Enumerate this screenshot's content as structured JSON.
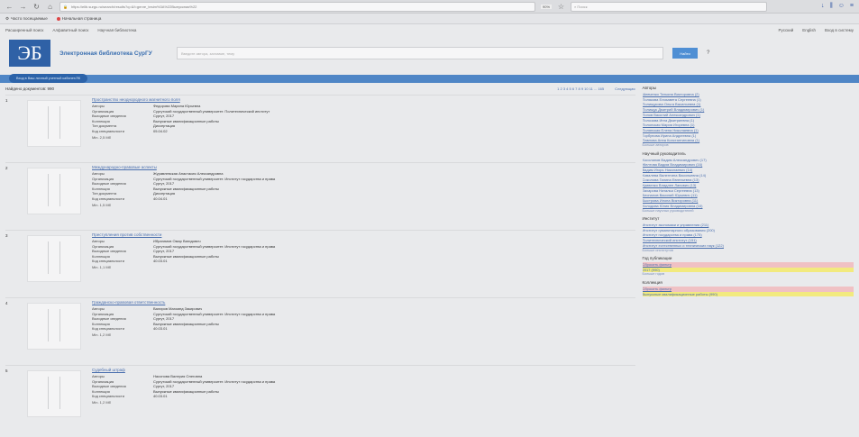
{
  "browser": {
    "url": "https://elib.surgu.ru/search/results?q=&f=genre_tesim%3A%22Выпускная%22",
    "zoom": "90%",
    "search_placeholder": "Поиск"
  },
  "bookmarks": [
    {
      "label": "Часто посещаемые"
    },
    {
      "label": "Начальная страница"
    }
  ],
  "topnav": {
    "links": [
      "Расширенный поиск",
      "Алфавитный поиск",
      "Научная библиотека"
    ],
    "lang_ru": "Русский",
    "lang_en": "English",
    "login": "Вход в систему"
  },
  "header": {
    "logo": "ЭБ",
    "title": "Электронная библиотека СурГУ",
    "search_placeholder": "Введите автора, заглавие, тему",
    "search_button": "Найти",
    "help": "?"
  },
  "band": {
    "pill": "Вход в Ваш личный учетный кабинет/ЛК"
  },
  "results": {
    "found": "Найдено документов: 990",
    "pages": "1 2 3 4 5 6 7 8 9 10 11 ... 165",
    "next": "Следующая",
    "labels": {
      "authors": "Авторы",
      "org": "Организация",
      "imprint": "Выходные сведения",
      "collection": "Коллекция",
      "doctype": "Тип документа",
      "code": "Код специальности"
    },
    "items": [
      {
        "num": "1",
        "title": "Пространство неоднородного магнитного поля",
        "authors": "Федорова Марина Юрьевна",
        "org": "Сургутский государственный университет. Политехнический институт",
        "imprint": "Сургут, 2017",
        "collection": "Выпускные квалификационные работы",
        "doctype": "Диссертация",
        "code": "05.04.02",
        "size": "Min. 2,5 Мб"
      },
      {
        "num": "2",
        "title": "Международно-правовые аспекты",
        "authors": "Журавлевская Анастасия Александровна",
        "org": "Сургутский государственный университет. Институт государства и права",
        "imprint": "Сургут, 2017",
        "collection": "Выпускные квалификационные работы",
        "doctype": "Диссертация",
        "code": "40.04.01",
        "size": "Min. 1,5 Мб"
      },
      {
        "num": "3",
        "title": "Преступления против собственности",
        "authors": "Ибрагимов Омар Вагидович",
        "org": "Сургутский государственный университет. Институт государства и права",
        "imprint": "Сургут, 2017",
        "collection": "Выпускные квалификационные работы",
        "doctype": "",
        "code": "40.03.01",
        "size": "Min. 1,1 Мб"
      },
      {
        "num": "4",
        "title": "Гражданско-правовая ответственность",
        "authors": "Валиров Магомед Закирович",
        "org": "Сургутский государственный университет. Институт государства и права",
        "imprint": "Сургут, 2017",
        "collection": "Выпускные квалификационные работы",
        "doctype": "",
        "code": "40.03.01",
        "size": "Min. 1,2 Мб"
      },
      {
        "num": "5",
        "title": "Судебный штраф",
        "authors": "Насонова Валерия Олеговна",
        "org": "Сургутский государственный университет. Институт государства и права",
        "imprint": "Сургут, 2017",
        "collection": "Выпускные квалификационные работы",
        "doctype": "",
        "code": "40.03.01",
        "size": "Min. 1,2 Мб"
      }
    ]
  },
  "facets": [
    {
      "title": "Авторы",
      "items": [
        "Шевченко Татьяна Викторовна (2)",
        "Полякова Елизавета Сергеевна (1)",
        "Полищукова Ольга Васильевна (1)",
        "Полищук Дмитрий Владимирович (1)",
        "Попов Василий Александрович (1)",
        "Полозова Инга Дмитриевна (1)",
        "Полонская Мария Игоревна (1)",
        "Полянская Елена Николаевна (1)",
        "Горбунова Ирина Андреевна (1)",
        "Павлова Анна Константиновна (1)"
      ],
      "more": "Больше авторов",
      "hl": []
    },
    {
      "title": "Научный руководитель",
      "items": [
        "Косолапов Вадим Александрович (17)",
        "Желтова Вадим Владимирович (16)",
        "Вадим Игорь Николаевич (14)",
        "Ковалева Валентина Васильевна (14)",
        "Соколова Галина Евгеньевна (13)",
        "Кривенко Владлен Ланович (13)",
        "Захарова Наталья Сергеевна (13)",
        "Беспалов Василий Юрьевич (11)",
        "Быстрова Илона Викторовна (11)",
        "Холодова Юлия Владимировна (10)"
      ],
      "more": "Больше научных руководителей",
      "hl": []
    },
    {
      "title": "Институт",
      "items": [
        "Институт экономики и управления (211)",
        "Институт гуманитарного образования (200)",
        "Институт государства и права (175)",
        "Политехнический институт (151)",
        "Институт естественных и технических наук (122)"
      ],
      "more": "Больше институтов",
      "hl": []
    },
    {
      "title": "Год публикации",
      "items": [
        "Сбросить фильтр",
        "2017 (990)"
      ],
      "more": "Больше годов",
      "hl": [
        "red",
        "yellow"
      ]
    },
    {
      "title": "Коллекция",
      "items": [
        "Сбросить фильтр",
        "Выпускные квалификационные работы (990)"
      ],
      "more": "",
      "hl": [
        "red",
        "yellow"
      ]
    }
  ]
}
